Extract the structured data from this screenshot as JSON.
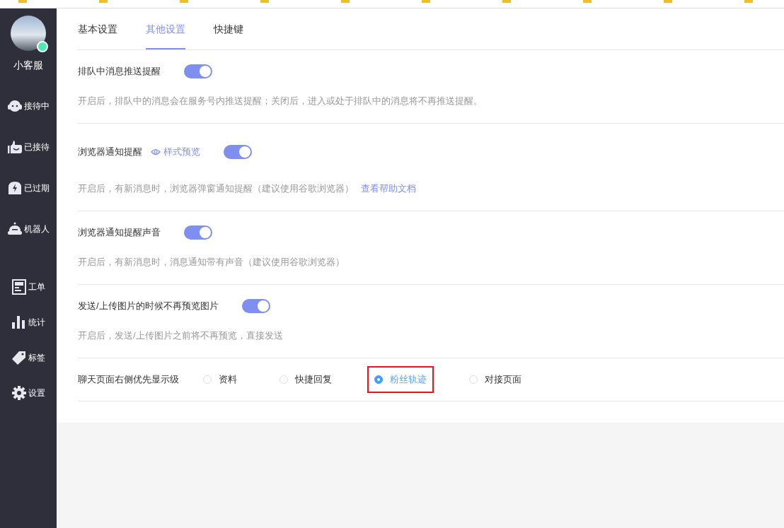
{
  "sidebar": {
    "user": {
      "name": "小客服",
      "online": true
    },
    "items": [
      {
        "label": "接待中"
      },
      {
        "label": "已接待"
      },
      {
        "label": "已过期"
      },
      {
        "label": "机器人"
      },
      {
        "label": "工单"
      },
      {
        "label": "统计"
      },
      {
        "label": "标签"
      },
      {
        "label": "设置"
      }
    ]
  },
  "tabs": [
    {
      "label": "基本设置",
      "selected": false
    },
    {
      "label": "其他设置",
      "selected": true
    },
    {
      "label": "快捷键",
      "selected": false
    }
  ],
  "sections": [
    {
      "kind": "toggle",
      "title": "排队中消息推送提醒",
      "on": true,
      "description": "开启后，排队中的消息会在服务号内推送提醒；关闭后，进入或处于排队中的消息将不再推送提醒。"
    },
    {
      "kind": "toggle",
      "title": "浏览器通知提醒",
      "preview_link": "样式预览",
      "on": true,
      "description": "开启后，有新消息时，浏览器弹窗通知提醒（建议使用谷歌浏览器）",
      "help_link": "查看帮助文档"
    },
    {
      "kind": "toggle",
      "title": "浏览器通知提醒声音",
      "on": true,
      "description": "开启后，有新消息时，消息通知带有声音（建议使用谷歌浏览器）"
    },
    {
      "kind": "toggle",
      "title": "发送/上传图片的时候不再预览图片",
      "on": true,
      "description": "开启后，发送/上传图片之前将不再预览，直接发送"
    },
    {
      "kind": "radio",
      "title": "聊天页面右侧优先显示级",
      "options": [
        {
          "label": "资料",
          "selected": false,
          "highlighted": false
        },
        {
          "label": "快捷回复",
          "selected": false,
          "highlighted": false
        },
        {
          "label": "粉丝轨迹",
          "selected": true,
          "highlighted": true
        },
        {
          "label": "对接页面",
          "selected": false,
          "highlighted": false
        }
      ]
    }
  ]
}
